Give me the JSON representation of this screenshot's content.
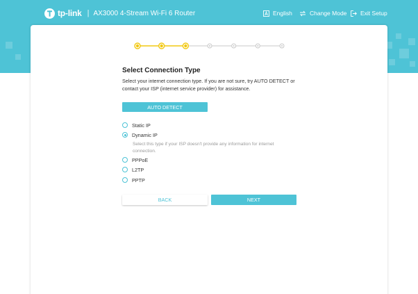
{
  "brand": {
    "logo_text": "tp-link",
    "model": "AX3000 4-Stream Wi-Fi 6 Router",
    "accent": "#4ec3d6",
    "step_active_color": "#f2c811"
  },
  "topnav": {
    "language_label": "English",
    "change_mode_label": "Change Mode",
    "exit_label": "Exit Setup"
  },
  "wizard": {
    "steps_total": 7,
    "steps_completed": 3
  },
  "page": {
    "title": "Select Connection Type",
    "description": "Select your internet connection type. If you are not sure, try AUTO DETECT or contact your ISP (internet service provider) for assistance.",
    "auto_detect_label": "AUTO DETECT"
  },
  "options": [
    {
      "label": "Static IP",
      "checked": false
    },
    {
      "label": "Dynamic IP",
      "checked": true,
      "help": "Select this type if your ISP doesn't provide any information for internet connection."
    },
    {
      "label": "PPPoE",
      "checked": false
    },
    {
      "label": "L2TP",
      "checked": false
    },
    {
      "label": "PPTP",
      "checked": false
    }
  ],
  "buttons": {
    "back_label": "BACK",
    "next_label": "NEXT"
  }
}
